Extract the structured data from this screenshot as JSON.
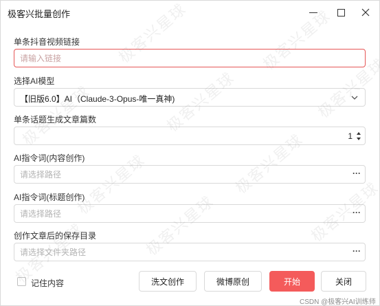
{
  "window": {
    "title": "极客兴批量创作"
  },
  "watermark": {
    "text": "极客兴星球"
  },
  "fields": {
    "link": {
      "label": "单条抖音视频链接",
      "placeholder": "请输入链接"
    },
    "model": {
      "label": "选择AI模型",
      "value": "【旧版6.0】AI（Claude-3-Opus-唯一真神)"
    },
    "count": {
      "label": "单条话题生成文章篇数",
      "value": "1"
    },
    "content_prompt": {
      "label": "AI指令词(内容创作)",
      "placeholder": "请选择路径",
      "button": "···"
    },
    "title_prompt": {
      "label": "AI指令词(标题创作)",
      "placeholder": "请选择路径",
      "button": "···"
    },
    "save_dir": {
      "label": "创作文章后的保存目录",
      "placeholder": "请选择文件夹路径",
      "button": "···"
    }
  },
  "footer": {
    "remember_label": "记住内容",
    "buttons": {
      "wash": "洗文创作",
      "weibo": "微博原创",
      "start": "开始",
      "close": "关闭"
    },
    "credit": "CSDN @极客兴AI训练师"
  },
  "colors": {
    "accent": "#f45b5b",
    "error_border": "#e65555",
    "border": "#d9d9d9"
  }
}
